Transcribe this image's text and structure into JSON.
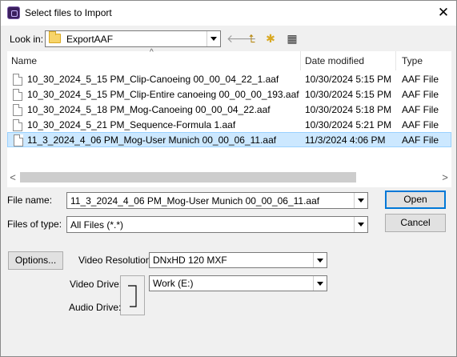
{
  "dialog": {
    "title": "Select files to Import",
    "close_glyph": "✕"
  },
  "lookin": {
    "label": "Look in:",
    "value": "ExportAAF"
  },
  "toolbar": {
    "back_glyph": "🡐",
    "up_glyph": "⮤",
    "newfolder_glyph": "✱",
    "views_glyph": "▦"
  },
  "columns": {
    "name": "Name",
    "date": "Date modified",
    "type": "Type",
    "sort_glyph": "^"
  },
  "files": [
    {
      "name": "10_30_2024_5_15 PM_Clip-Canoeing 00_00_04_22_1.aaf",
      "date": "10/30/2024 5:15 PM",
      "type": "AAF File",
      "selected": false
    },
    {
      "name": "10_30_2024_5_15 PM_Clip-Entire canoeing 00_00_00_193.aaf",
      "date": "10/30/2024 5:15 PM",
      "type": "AAF File",
      "selected": false
    },
    {
      "name": "10_30_2024_5_18 PM_Mog-Canoeing 00_00_04_22.aaf",
      "date": "10/30/2024 5:18 PM",
      "type": "AAF File",
      "selected": false
    },
    {
      "name": "10_30_2024_5_21 PM_Sequence-Formula 1.aaf",
      "date": "10/30/2024 5:21 PM",
      "type": "AAF File",
      "selected": false
    },
    {
      "name": "11_3_2024_4_06 PM_Mog-User Munich 00_00_06_11.aaf",
      "date": "11/3/2024 4:06 PM",
      "type": "AAF File",
      "selected": true
    }
  ],
  "scroll": {
    "left_glyph": "<",
    "right_glyph": ">"
  },
  "filename": {
    "label": "File name:",
    "value": "11_3_2024_4_06 PM_Mog-User Munich 00_00_06_11.aaf"
  },
  "filetype": {
    "label": "Files of type:",
    "value": "All Files (*.*)"
  },
  "buttons": {
    "open": "Open",
    "cancel": "Cancel",
    "options": "Options..."
  },
  "video_resolution": {
    "label": "Video Resolution:",
    "value": "DNxHD 120  MXF"
  },
  "video_drive": {
    "label": "Video Drive:",
    "value": "Work (E:)"
  },
  "audio_drive": {
    "label": "Audio Drive:"
  },
  "drive_link_glyph": "⌐"
}
